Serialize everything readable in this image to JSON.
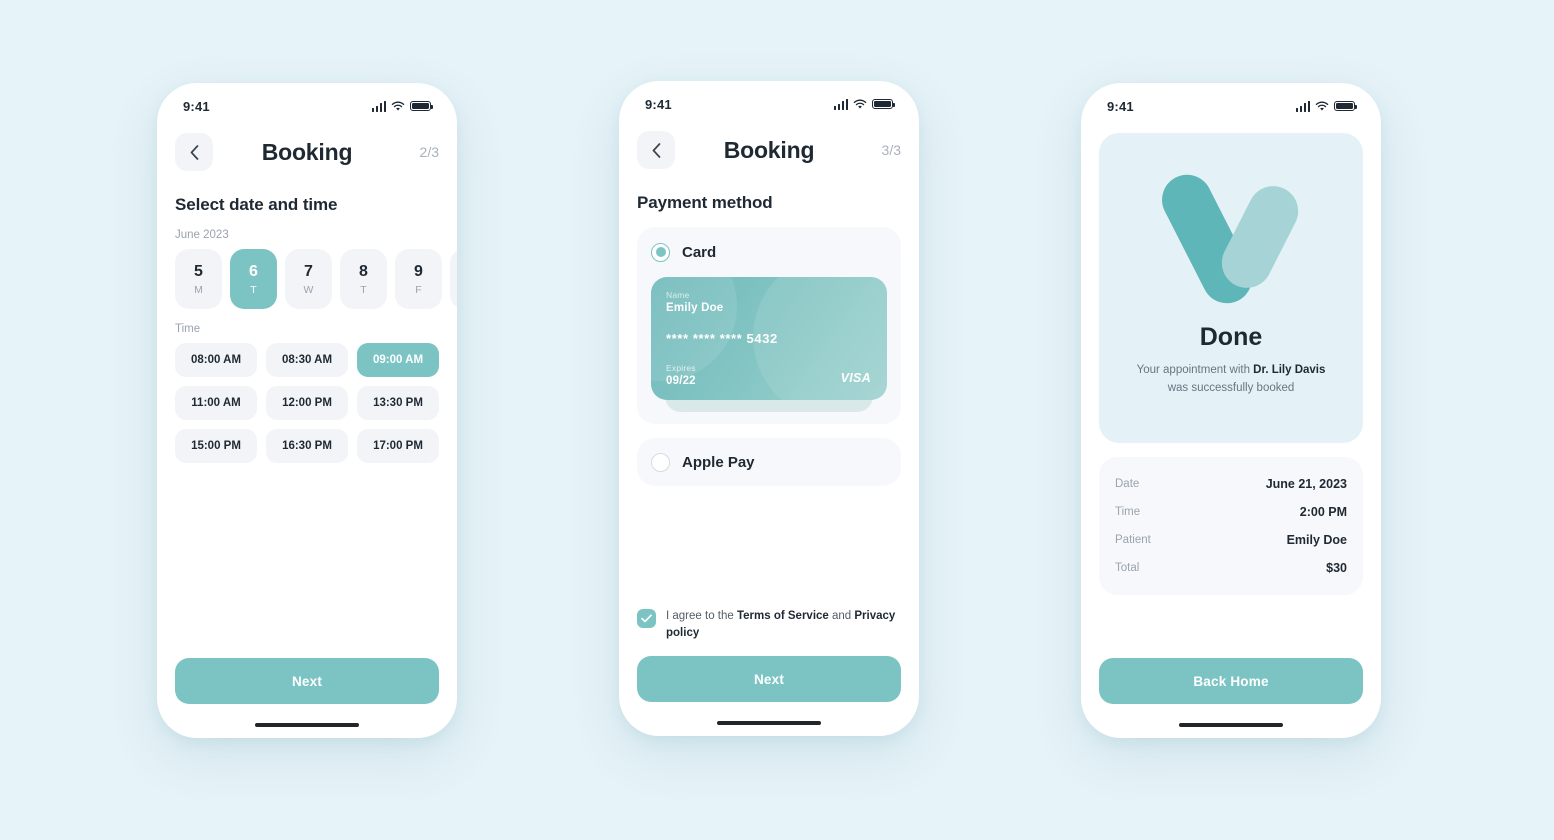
{
  "theme": {
    "page_bg": "#e6f3f8",
    "accent": "#7cc4c4",
    "accent_dark": "#5fb6b8",
    "accent_light": "#a6d3d6",
    "surface": "#f2f4f8",
    "text": "#1f2933",
    "muted": "#9aa3af"
  },
  "status_bar": {
    "time": "9:41"
  },
  "screen_date": {
    "nav": {
      "title": "Booking",
      "step": "2/3",
      "back_icon": "chevron-left-icon"
    },
    "heading": "Select date and time",
    "month_label": "June 2023",
    "dates": [
      {
        "day": "5",
        "dow": "M",
        "selected": false
      },
      {
        "day": "6",
        "dow": "T",
        "selected": true
      },
      {
        "day": "7",
        "dow": "W",
        "selected": false
      },
      {
        "day": "8",
        "dow": "T",
        "selected": false
      },
      {
        "day": "9",
        "dow": "F",
        "selected": false
      }
    ],
    "time_label": "Time",
    "times": [
      {
        "label": "08:00 AM",
        "selected": false
      },
      {
        "label": "08:30 AM",
        "selected": false
      },
      {
        "label": "09:00 AM",
        "selected": true
      },
      {
        "label": "11:00 AM",
        "selected": false
      },
      {
        "label": "12:00 PM",
        "selected": false
      },
      {
        "label": "13:30 PM",
        "selected": false
      },
      {
        "label": "15:00 PM",
        "selected": false
      },
      {
        "label": "16:30 PM",
        "selected": false
      },
      {
        "label": "17:00 PM",
        "selected": false
      }
    ],
    "next_label": "Next"
  },
  "screen_payment": {
    "nav": {
      "title": "Booking",
      "step": "3/3",
      "back_icon": "chevron-left-icon"
    },
    "heading": "Payment method",
    "card_option": {
      "label": "Card",
      "selected": true
    },
    "card": {
      "name_label": "Name",
      "name_value": "Emily Doe",
      "number": "**** **** **** 5432",
      "expires_label": "Expires",
      "expires_value": "09/22",
      "brand": "VISA"
    },
    "apple_pay_option": {
      "label": "Apple Pay",
      "selected": false
    },
    "terms": {
      "checked": true,
      "prefix": "I agree to the ",
      "link1": "Terms of Service",
      "middle": " and ",
      "link2": "Privacy policy"
    },
    "next_label": "Next"
  },
  "screen_done": {
    "logo_icon": "check-heart-logo",
    "title": "Done",
    "message_prefix": "Your appointment with ",
    "message_doctor": "Dr. Lily Davis",
    "message_suffix": "was successfully booked",
    "summary": [
      {
        "key": "Date",
        "value": "June 21, 2023"
      },
      {
        "key": "Time",
        "value": "2:00 PM"
      },
      {
        "key": "Patient",
        "value": "Emily Doe"
      },
      {
        "key": "Total",
        "value": "$30"
      }
    ],
    "back_home_label": "Back Home"
  }
}
